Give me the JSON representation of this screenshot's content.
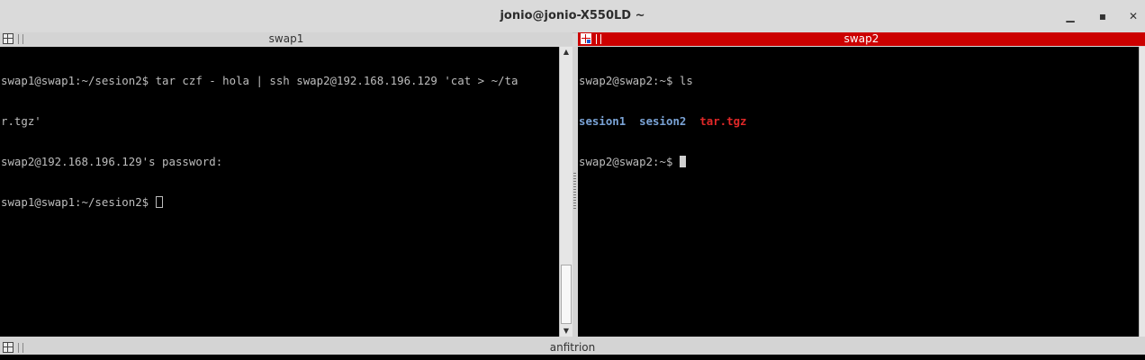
{
  "window": {
    "title": "jonio@jonio-X550LD ~",
    "minimize_glyph": "▁",
    "maximize_glyph": "▪",
    "close_glyph": "✕"
  },
  "panes": {
    "left": {
      "title": "swap1",
      "lines": [
        "swap1@swap1:~/sesion2$ tar czf - hola | ssh swap2@192.168.196.129 'cat > ~/ta",
        "r.tgz'",
        "swap2@192.168.196.129's password: "
      ],
      "prompt": "swap1@swap1:~/sesion2$ "
    },
    "right": {
      "title": "swap2",
      "command_line": "swap2@swap2:~$ ls",
      "listing": {
        "dir1": "sesion1",
        "dir2": "sesion2",
        "file": "tar.tgz"
      },
      "prompt": "swap2@swap2:~$ "
    },
    "bottom": {
      "title": "anfitrion"
    }
  },
  "colors": {
    "active_header": "#cc0000",
    "directory": "#7aa3d6",
    "archive": "#e02828",
    "terminal_bg": "#000000",
    "terminal_fg": "#bdbdbd"
  },
  "scroll": {
    "left_position_fraction": 0.96
  }
}
